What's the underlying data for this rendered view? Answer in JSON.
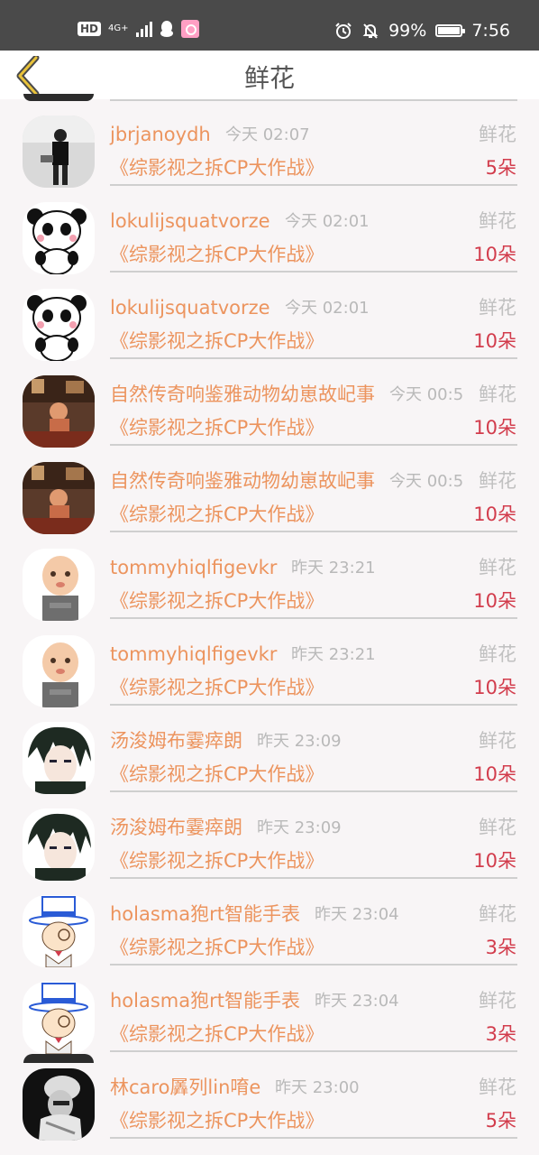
{
  "status_bar": {
    "hd": "HD",
    "network": "4G+",
    "battery": "99%",
    "time": "7:56"
  },
  "header": {
    "title": "鲜花"
  },
  "colors": {
    "accent_orange": "#ec945e",
    "count_red": "#d23c4c",
    "muted_gray": "#b9b9b9"
  },
  "records": [
    {
      "user": "jbrjanoydh",
      "time": "今天 02:07",
      "type": "鲜花",
      "book": "《综影视之拆CP大作战》",
      "count": "5朵",
      "avatar": "photo-avatar"
    },
    {
      "user": "lokulijsquatvorze",
      "time": "今天 02:01",
      "type": "鲜花",
      "book": "《综影视之拆CP大作战》",
      "count": "10朵",
      "avatar": "panda-avatar"
    },
    {
      "user": "lokulijsquatvorze",
      "time": "今天 02:01",
      "type": "鲜花",
      "book": "《综影视之拆CP大作战》",
      "count": "10朵",
      "avatar": "panda-avatar"
    },
    {
      "user": "自然传奇响鉴雅动物幼崽故屺事",
      "time": "今天 00:5",
      "type": "鲜花",
      "book": "《综影视之拆CP大作战》",
      "count": "10朵",
      "avatar": "cafe-avatar"
    },
    {
      "user": "自然传奇响鉴雅动物幼崽故屺事",
      "time": "今天 00:5",
      "type": "鲜花",
      "book": "《综影视之拆CP大作战》",
      "count": "10朵",
      "avatar": "cafe-avatar"
    },
    {
      "user": "tommyhiqlfigevkr",
      "time": "昨天 23:21",
      "type": "鲜花",
      "book": "《综影视之拆CP大作战》",
      "count": "10朵",
      "avatar": "baby-avatar"
    },
    {
      "user": "tommyhiqlfigevkr",
      "time": "昨天 23:21",
      "type": "鲜花",
      "book": "《综影视之拆CP大作战》",
      "count": "10朵",
      "avatar": "baby-avatar"
    },
    {
      "user": "汤浚姆布霎瘁朗",
      "time": "昨天 23:09",
      "type": "鲜花",
      "book": "《综影视之拆CP大作战》",
      "count": "10朵",
      "avatar": "anime-avatar"
    },
    {
      "user": "汤浚姆布霎瘁朗",
      "time": "昨天 23:09",
      "type": "鲜花",
      "book": "《综影视之拆CP大作战》",
      "count": "10朵",
      "avatar": "anime-avatar"
    },
    {
      "user": "holasma狍rt智能手表",
      "time": "昨天 23:04",
      "type": "鲜花",
      "book": "《综影视之拆CP大作战》",
      "count": "3朵",
      "avatar": "kid-hat-avatar"
    },
    {
      "user": "holasma狍rt智能手表",
      "time": "昨天 23:04",
      "type": "鲜花",
      "book": "《综影视之拆CP大作战》",
      "count": "3朵",
      "avatar": "kid-hat-avatar"
    },
    {
      "user": "林caro羼列lin唷e",
      "time": "昨天 23:00",
      "type": "鲜花",
      "book": "《综影视之拆CP大作战》",
      "count": "5朵",
      "avatar": "bw-avatar"
    }
  ]
}
